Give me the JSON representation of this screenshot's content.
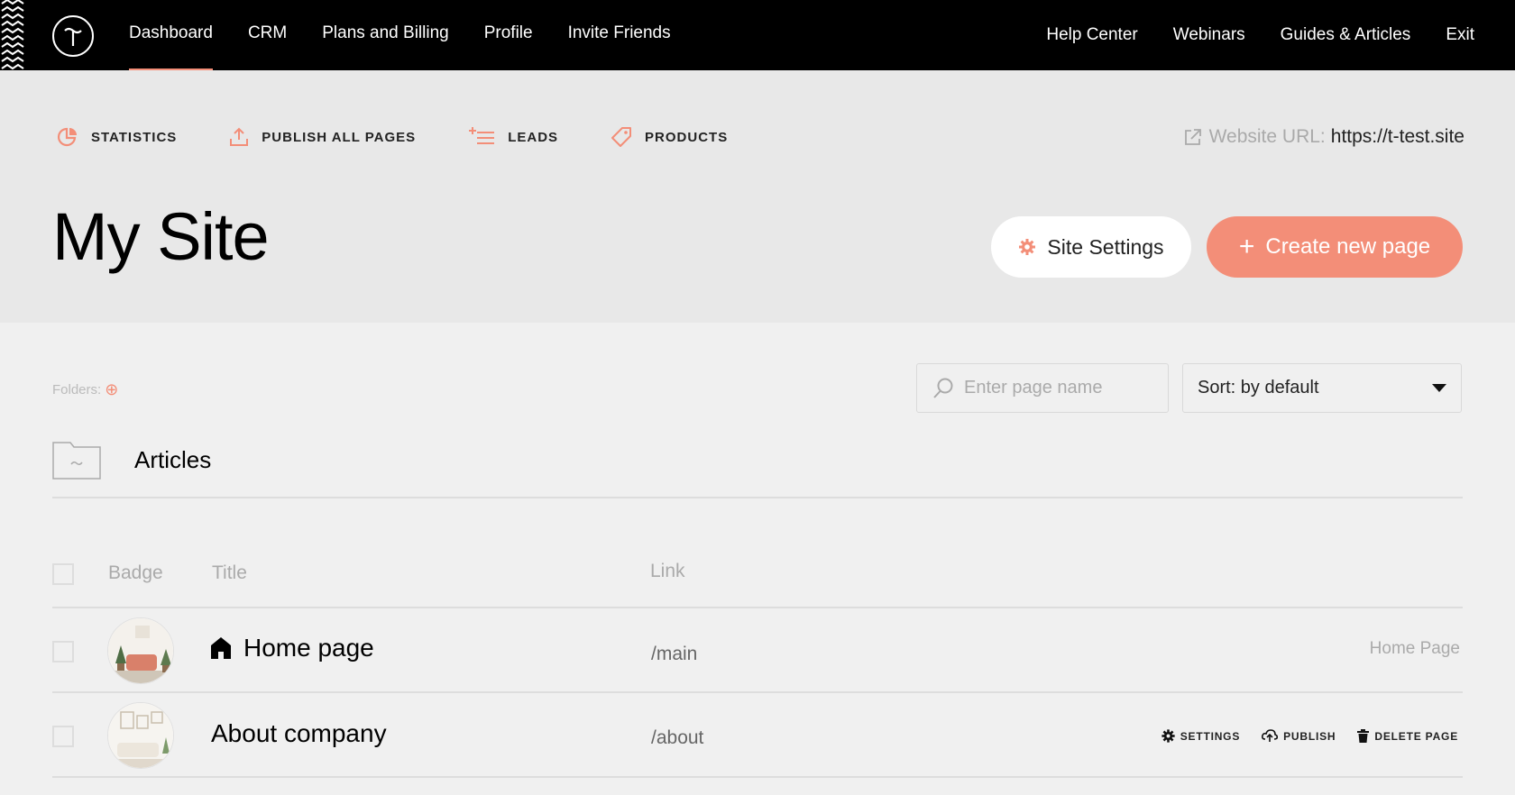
{
  "nav": {
    "left": [
      {
        "label": "Dashboard",
        "active": true
      },
      {
        "label": "CRM"
      },
      {
        "label": "Plans and Billing"
      },
      {
        "label": "Profile"
      },
      {
        "label": "Invite Friends"
      }
    ],
    "right": [
      {
        "label": "Help Center"
      },
      {
        "label": "Webinars"
      },
      {
        "label": "Guides & Articles"
      },
      {
        "label": "Exit"
      }
    ]
  },
  "toolbar": {
    "statistics": "STATISTICS",
    "publish_all": "PUBLISH ALL PAGES",
    "leads": "LEADS",
    "products": "PRODUCTS"
  },
  "website_url": {
    "label": "Website URL:",
    "value": "https://t-test.site"
  },
  "page_title": "My Site",
  "buttons": {
    "site_settings": "Site Settings",
    "create_page": "Create new page",
    "create_plus": "+"
  },
  "folders": {
    "label": "Folders:",
    "add_symbol": "⊕"
  },
  "search": {
    "placeholder": "Enter page name"
  },
  "sort": {
    "value": "Sort: by default"
  },
  "folder_items": [
    {
      "name": "Articles"
    }
  ],
  "table": {
    "headers": {
      "badge": "Badge",
      "title": "Title",
      "link": "Link"
    },
    "rows": [
      {
        "title": "Home page",
        "link": "/main",
        "tag": "Home Page",
        "is_home": true
      },
      {
        "title": "About company",
        "link": "/about",
        "actions": [
          "SETTINGS",
          "PUBLISH",
          "DELETE PAGE"
        ]
      }
    ]
  },
  "colors": {
    "accent": "#f38e78",
    "nav_bg": "#000000",
    "header_bg": "#e8e8e8",
    "page_bg": "#f0f0f0"
  }
}
